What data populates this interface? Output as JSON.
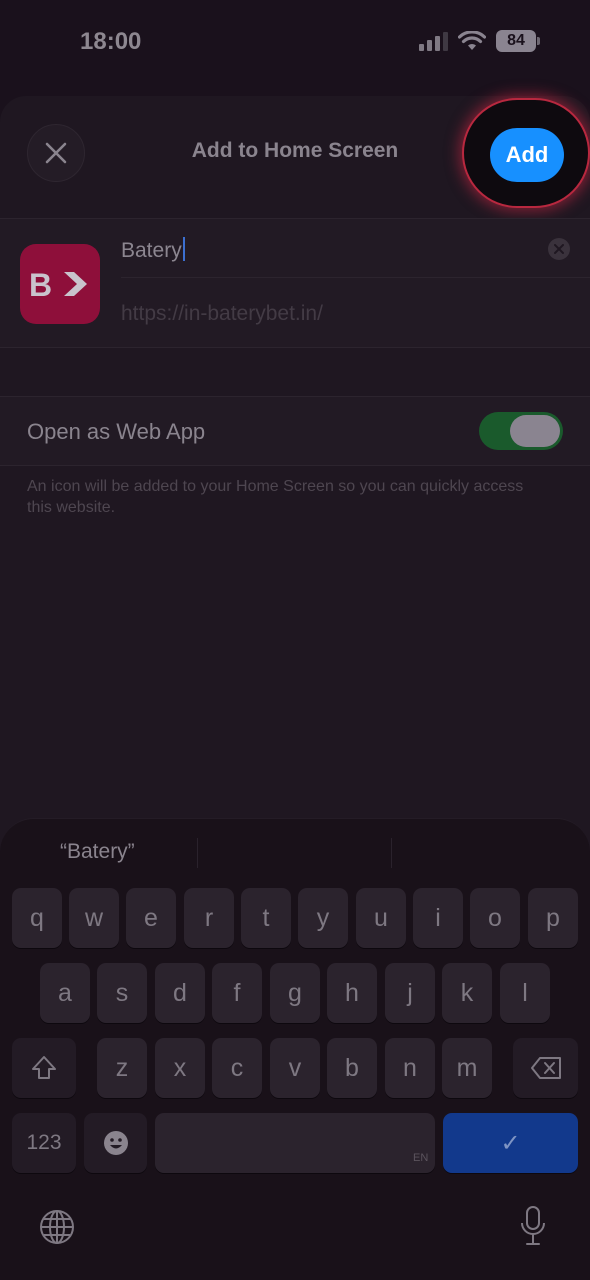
{
  "status": {
    "time": "18:00",
    "battery": "84"
  },
  "sheet": {
    "title": "Add to Home Screen",
    "add_label": "Add",
    "app_icon_text": "B",
    "name_value": "Batery",
    "url": "https://in-baterybet.in/",
    "toggle_label": "Open as Web App",
    "toggle_on": true,
    "footnote": "An icon will be added to your Home Screen so you can quickly access this website."
  },
  "keyboard": {
    "suggestion": "“Batery”",
    "row1": [
      "q",
      "w",
      "e",
      "r",
      "t",
      "y",
      "u",
      "i",
      "o",
      "p"
    ],
    "row2": [
      "a",
      "s",
      "d",
      "f",
      "g",
      "h",
      "j",
      "k",
      "l"
    ],
    "row3": [
      "z",
      "x",
      "c",
      "v",
      "b",
      "n",
      "m"
    ],
    "numbers_label": "123",
    "space_lang": "EN",
    "return_symbol": "✓"
  },
  "colors": {
    "accent": "#1790ff",
    "highlight_ring": "#b8283f",
    "app_icon_bg": "#8e0f3a",
    "toggle_on": "#1a5a2c"
  }
}
